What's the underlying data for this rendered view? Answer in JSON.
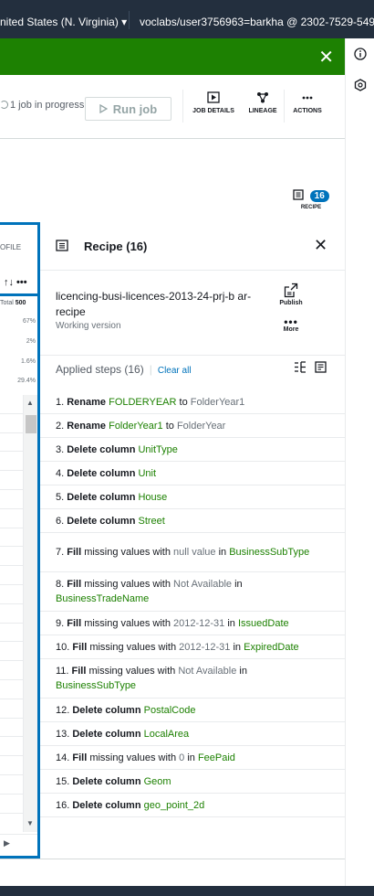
{
  "topbar": {
    "region": "nited States (N. Virginia) ▾",
    "account": "voclabs/user3756963=barkha @ 2302-7529-5496 ▾"
  },
  "banner": {
    "close_glyph": "✕",
    "color": "#1d8102"
  },
  "toolbar": {
    "job_progress": "1 job in progress",
    "run_job": "Run job",
    "job_details": "JOB DETAILS",
    "lineage": "LINEAGE",
    "actions": "ACTIONS"
  },
  "recipe_toggle": {
    "count": "16",
    "label": "RECIPE"
  },
  "grid": {
    "tab_label": "OFILE",
    "sort_glyph": "↑↓ •••",
    "total_label": "Total",
    "total_value": "500",
    "stats": [
      "67%",
      "2%",
      "1.6%",
      "29.4%"
    ]
  },
  "recipe": {
    "title": "Recipe (16)",
    "name": "licencing-busi-licences-2013-24-prj-b ar-recipe",
    "version": "Working version",
    "publish": "Publish",
    "more": "More",
    "steps_header": "Applied steps (16)",
    "clear_all": "Clear all",
    "steps": [
      {
        "num": "1.",
        "parts": [
          [
            "op",
            "Rename"
          ],
          [
            "green",
            "FOLDERYEAR"
          ],
          [
            "plain",
            "to"
          ],
          [
            "grey",
            "FolderYear1"
          ]
        ]
      },
      {
        "num": "2.",
        "parts": [
          [
            "op",
            "Rename"
          ],
          [
            "green",
            "FolderYear1"
          ],
          [
            "plain",
            "to"
          ],
          [
            "grey",
            "FolderYear"
          ]
        ]
      },
      {
        "num": "3.",
        "parts": [
          [
            "op",
            "Delete column"
          ],
          [
            "green",
            "UnitType"
          ]
        ]
      },
      {
        "num": "4.",
        "parts": [
          [
            "op",
            "Delete column"
          ],
          [
            "green",
            "Unit"
          ]
        ]
      },
      {
        "num": "5.",
        "parts": [
          [
            "op",
            "Delete column"
          ],
          [
            "green",
            "House"
          ]
        ]
      },
      {
        "num": "6.",
        "parts": [
          [
            "op",
            "Delete column"
          ],
          [
            "green",
            "Street"
          ]
        ]
      },
      {
        "num": "7.",
        "parts": [
          [
            "op",
            "Fill"
          ],
          [
            "plain",
            "missing values with"
          ],
          [
            "grey",
            "null value"
          ],
          [
            "plain",
            "in"
          ],
          [
            "green",
            "BusinessSubType"
          ]
        ]
      },
      {
        "num": "8.",
        "parts": [
          [
            "op",
            "Fill"
          ],
          [
            "plain",
            "missing values with"
          ],
          [
            "grey",
            "Not Available"
          ],
          [
            "plain",
            "in"
          ],
          [
            "green",
            "BusinessTradeName"
          ]
        ]
      },
      {
        "num": "9.",
        "parts": [
          [
            "op",
            "Fill"
          ],
          [
            "plain",
            "missing values with"
          ],
          [
            "grey",
            "2012-12-31"
          ],
          [
            "plain",
            "in"
          ],
          [
            "green",
            "IssuedDate"
          ]
        ]
      },
      {
        "num": "10.",
        "parts": [
          [
            "op",
            "Fill"
          ],
          [
            "plain",
            "missing values with"
          ],
          [
            "grey",
            "2012-12-31"
          ],
          [
            "plain",
            "in"
          ],
          [
            "green",
            "ExpiredDate"
          ]
        ]
      },
      {
        "num": "11.",
        "parts": [
          [
            "op",
            "Fill"
          ],
          [
            "plain",
            "missing values with"
          ],
          [
            "grey",
            "Not Available"
          ],
          [
            "plain",
            "in"
          ],
          [
            "green",
            "BusinessSubType"
          ]
        ]
      },
      {
        "num": "12.",
        "parts": [
          [
            "op",
            "Delete column"
          ],
          [
            "green",
            "PostalCode"
          ]
        ]
      },
      {
        "num": "13.",
        "parts": [
          [
            "op",
            "Delete column"
          ],
          [
            "green",
            "LocalArea"
          ]
        ]
      },
      {
        "num": "14.",
        "parts": [
          [
            "op",
            "Fill"
          ],
          [
            "plain",
            "missing values with"
          ],
          [
            "grey",
            "0"
          ],
          [
            "plain",
            "in"
          ],
          [
            "green",
            "FeePaid"
          ]
        ]
      },
      {
        "num": "15.",
        "parts": [
          [
            "op",
            "Delete column"
          ],
          [
            "green",
            "Geom"
          ]
        ]
      },
      {
        "num": "16.",
        "parts": [
          [
            "op",
            "Delete column"
          ],
          [
            "green",
            "geo_point_2d"
          ]
        ]
      }
    ]
  }
}
